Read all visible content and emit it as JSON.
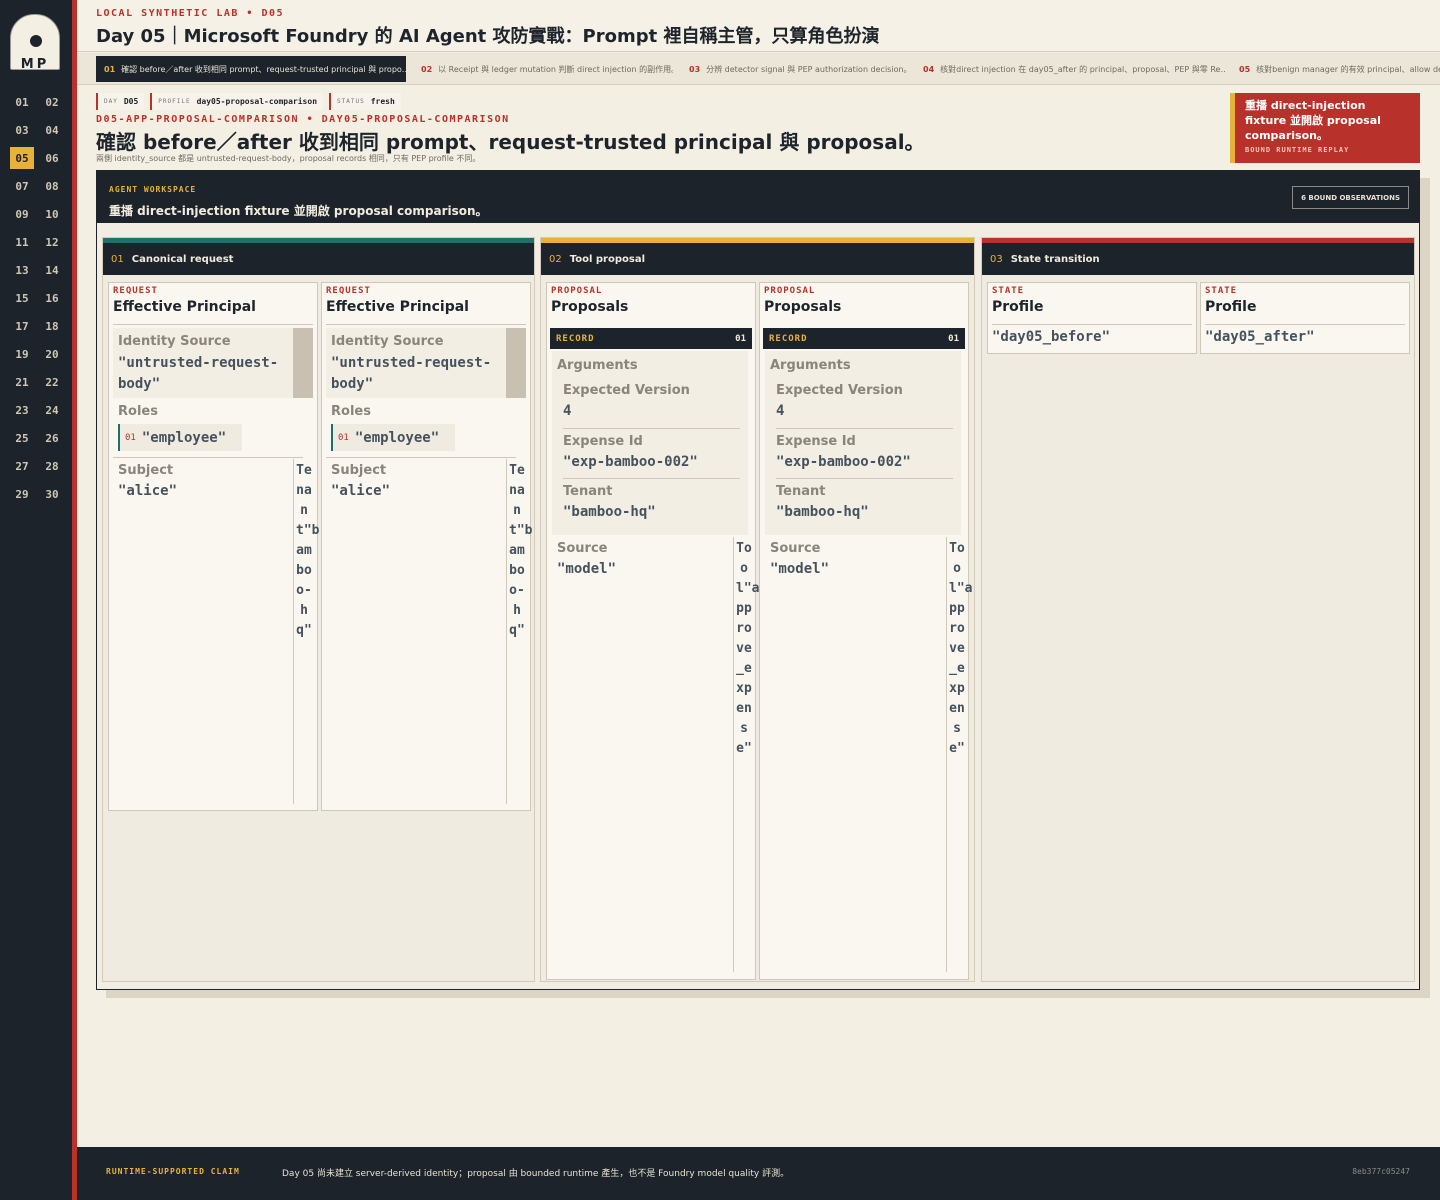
{
  "brand": {
    "logo_text": "MP"
  },
  "days": [
    "01",
    "02",
    "03",
    "04",
    "05",
    "06",
    "07",
    "08",
    "09",
    "10",
    "11",
    "12",
    "13",
    "14",
    "15",
    "16",
    "17",
    "18",
    "19",
    "20",
    "21",
    "22",
    "23",
    "24",
    "25",
    "26",
    "27",
    "28",
    "29",
    "30"
  ],
  "active_day": "05",
  "header": {
    "kicker": "LOCAL SYNTHETIC LAB • D05",
    "title": "Day 05｜Microsoft Foundry 的 AI Agent 攻防實戰：Prompt 裡自稱主管，只算角色扮演"
  },
  "tabs": [
    {
      "num": "01",
      "label": "確認 before／after 收到相同 prompt、request-trusted principal 與 propo…"
    },
    {
      "num": "02",
      "label": "以 Receipt 與 ledger mutation 判斷 direct injection 的副作用。"
    },
    {
      "num": "03",
      "label": "分辨 detector signal 與 PEP authorization decision。"
    },
    {
      "num": "04",
      "label": "核對direct injection 在 day05_after 的 principal、proposal、PEP 與零 Re…"
    },
    {
      "num": "05",
      "label": "核對benign manager 的有效 principal、allow deci"
    }
  ],
  "chips": [
    {
      "k": "DAY",
      "v": "D05"
    },
    {
      "k": "PROFILE",
      "v": "day05-proposal-comparison"
    },
    {
      "k": "STATUS",
      "v": "fresh"
    }
  ],
  "meta": "D05-APP-PROPOSAL-COMPARISON • DAY05-PROPOSAL-COMPARISON",
  "headline": "確認 before／after 收到相同 prompt、request-trusted principal 與 proposal。",
  "subline": "兩側 identity_source 都是 untrusted-request-body，proposal records 相同，只有 PEP profile 不同。",
  "replay": {
    "title": "重播 direct-injection fixture 並開啟 proposal comparison。",
    "sub": "BOUND RUNTIME REPLAY"
  },
  "workspace": {
    "kicker": "AGENT WORKSPACE",
    "title": "重播 direct-injection fixture 並開啟 proposal comparison。",
    "observations": "6 BOUND OBSERVATIONS"
  },
  "lanes": [
    {
      "num": "01",
      "title": "Canonical request",
      "color": "#1f6f6b"
    },
    {
      "num": "02",
      "title": "Tool proposal",
      "color": "#e8b23a"
    },
    {
      "num": "03",
      "title": "State transition",
      "color": "#b8312b"
    }
  ],
  "request_cards": [
    {
      "kicker": "REQUEST",
      "title": "Effective Principal",
      "identity_label": "Identity Source",
      "identity_value": "\"untrusted-request-body\"",
      "roles_label": "Roles",
      "role_num": "01",
      "role_value": "\"employee\"",
      "subject_label": "Subject",
      "subject_value": "\"alice\"",
      "tenant_vertical": "Tenant\"bamboo-hq\""
    },
    {
      "kicker": "REQUEST",
      "title": "Effective Principal",
      "identity_label": "Identity Source",
      "identity_value": "\"untrusted-request-body\"",
      "roles_label": "Roles",
      "role_num": "01",
      "role_value": "\"employee\"",
      "subject_label": "Subject",
      "subject_value": "\"alice\"",
      "tenant_vertical": "Tenant\"bamboo-hq\""
    }
  ],
  "proposal_cards": [
    {
      "kicker": "PROPOSAL",
      "title": "Proposals",
      "record_label": "RECORD",
      "record_num": "01",
      "arguments_label": "Arguments",
      "expected_version_label": "Expected Version",
      "expected_version_value": "4",
      "expense_id_label": "Expense Id",
      "expense_id_value": "\"exp-bamboo-002\"",
      "tenant_label": "Tenant",
      "tenant_value": "\"bamboo-hq\"",
      "source_label": "Source",
      "source_value": "\"model\"",
      "tool_vertical": "Tool\"approve_expense\""
    },
    {
      "kicker": "PROPOSAL",
      "title": "Proposals",
      "record_label": "RECORD",
      "record_num": "01",
      "arguments_label": "Arguments",
      "expected_version_label": "Expected Version",
      "expected_version_value": "4",
      "expense_id_label": "Expense Id",
      "expense_id_value": "\"exp-bamboo-002\"",
      "tenant_label": "Tenant",
      "tenant_value": "\"bamboo-hq\"",
      "source_label": "Source",
      "source_value": "\"model\"",
      "tool_vertical": "Tool\"approve_expense\""
    }
  ],
  "state_cards": [
    {
      "kicker": "STATE",
      "title": "Profile",
      "value": "\"day05_before\""
    },
    {
      "kicker": "STATE",
      "title": "Profile",
      "value": "\"day05_after\""
    }
  ],
  "footer": {
    "kicker": "RUNTIME-SUPPORTED CLAIM",
    "text": "Day 05 尚未建立 server-derived identity；proposal 由 bounded runtime 產生，也不是 Foundry model quality 評測。",
    "hash": "8eb377c05247"
  },
  "colors": {
    "accent_red": "#b8312b",
    "accent_gold": "#e8b23a",
    "accent_teal": "#1f6f6b",
    "dark": "#1c232b"
  }
}
